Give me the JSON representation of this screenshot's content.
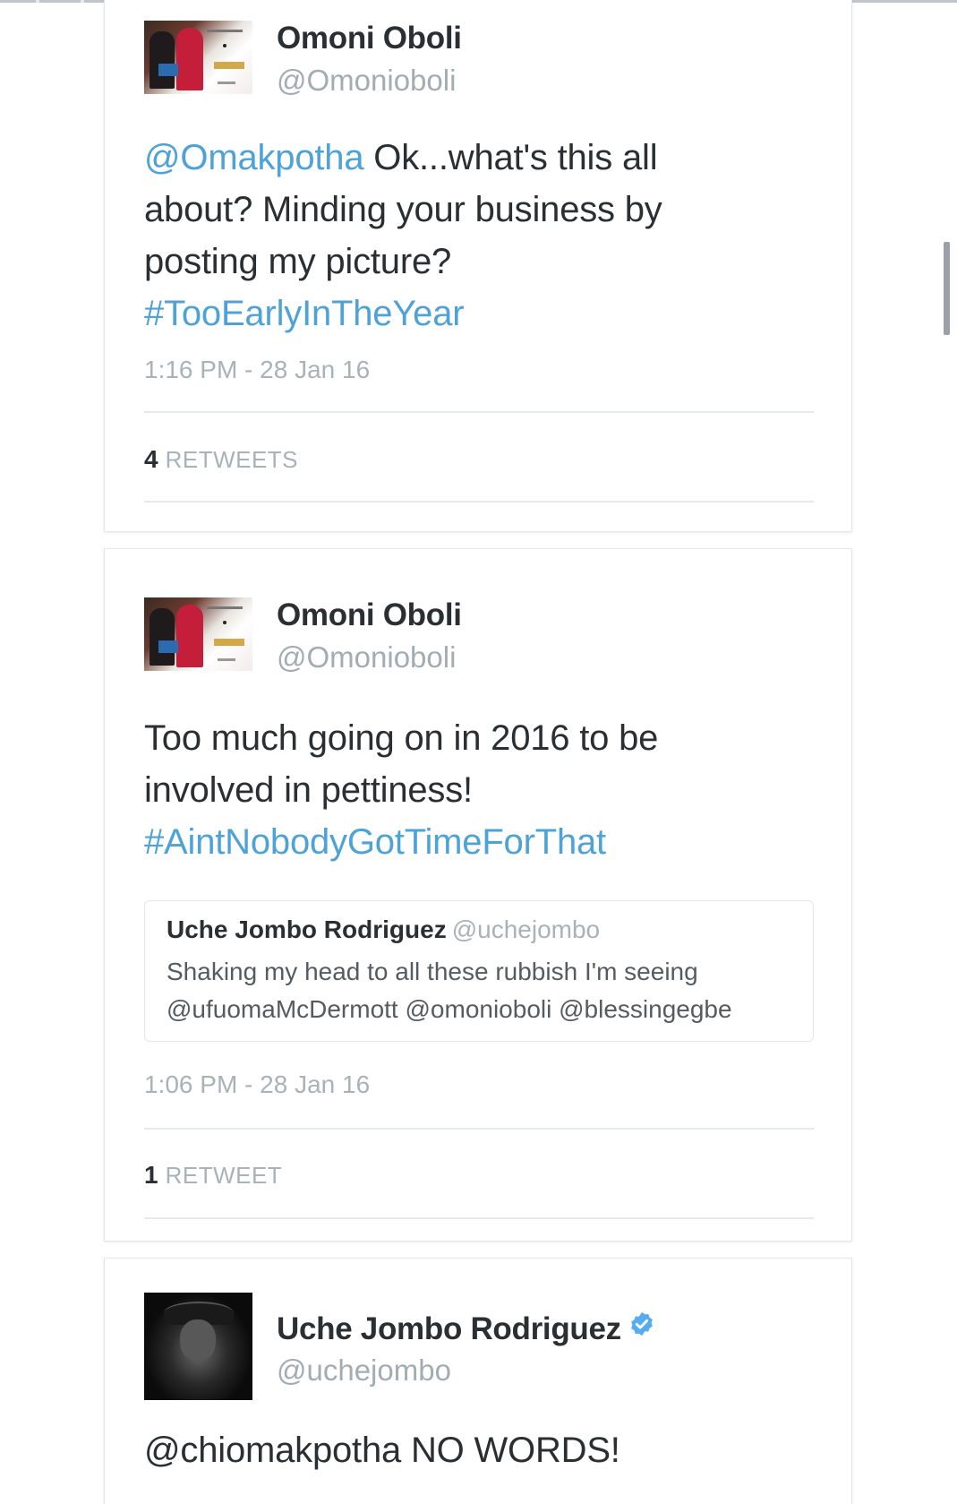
{
  "tweets": [
    {
      "author_name": "Omoni Oboli",
      "author_handle": "@Omonioboli",
      "text_mention": "@Omakpotha",
      "text_body_1": " Ok...what's this all",
      "text_body_2": "about?  Minding your business by",
      "text_body_3": "posting my picture?",
      "hashtag": "#TooEarlyInTheYear",
      "timestamp": "1:16 PM - 28 Jan 16",
      "retweet_count": "4",
      "retweet_label": "RETWEETS"
    },
    {
      "author_name": "Omoni Oboli",
      "author_handle": "@Omonioboli",
      "text_line_1": "Too much going on in 2016 to be",
      "text_line_2": "involved in pettiness!",
      "hashtag": "#AintNobodyGotTimeForThat",
      "quote": {
        "author_name": "Uche Jombo Rodriguez",
        "author_handle": "@uchejombo",
        "text_line_1": "Shaking my head to all these rubbish I'm seeing",
        "text_line_2": "@ufuomaMcDermott @omonioboli @blessingegbe"
      },
      "timestamp": "1:06 PM - 28 Jan 16",
      "retweet_count": "1",
      "retweet_label": "RETWEET"
    },
    {
      "author_name": "Uche Jombo Rodriguez",
      "author_handle": "@uchejombo",
      "verified": true,
      "text": "@chiomakpotha NO WORDS!"
    }
  ],
  "icons": {
    "verified": "verified-badge-icon",
    "avatar_1": "poster-avatar",
    "avatar_3": "portrait-avatar"
  },
  "colors": {
    "link": "#4da2d8",
    "text": "#292f33",
    "muted": "#a8b2b9",
    "verified": "#55acee"
  }
}
